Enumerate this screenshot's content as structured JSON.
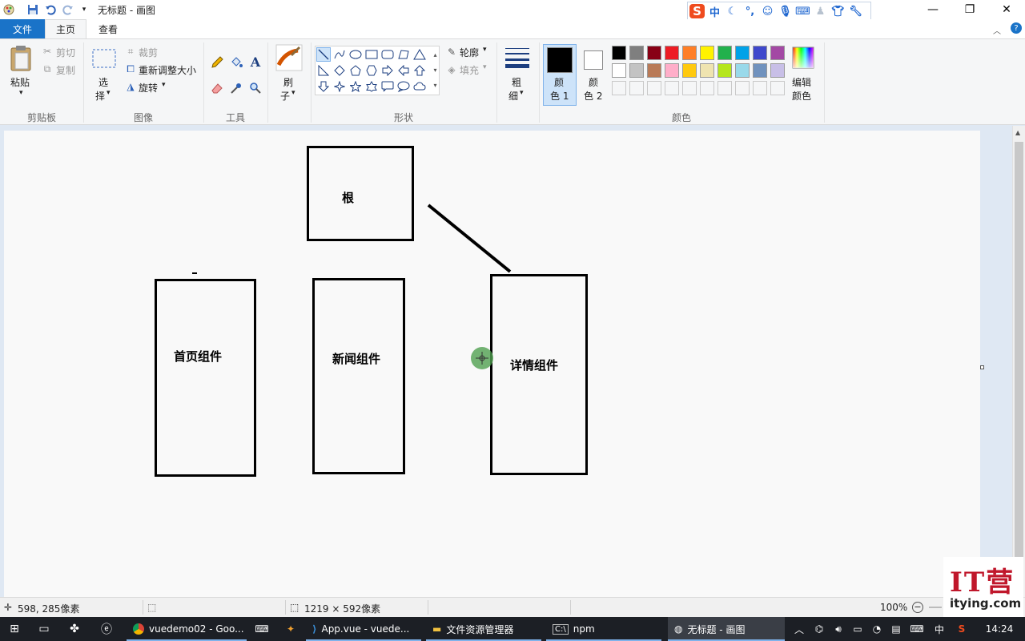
{
  "window": {
    "title": "无标题 - 画图"
  },
  "ime": {
    "logo": "S",
    "lang": "中",
    "icons": [
      "moon-icon",
      "punctuation-icon",
      "smiley-icon",
      "microphone-icon",
      "keyboard-icon",
      "user-icon",
      "shirt-icon",
      "wrench-icon"
    ]
  },
  "tabs": {
    "file": "文件",
    "home": "主页",
    "view": "查看"
  },
  "ribbon": {
    "clipboard": {
      "paste": "粘贴",
      "cut": "剪切",
      "copy": "复制",
      "group": "剪贴板"
    },
    "image": {
      "select_line1": "选",
      "select_line2": "择",
      "crop": "裁剪",
      "resize": "重新调整大小",
      "rotate": "旋转",
      "group": "图像"
    },
    "tools": {
      "group": "工具"
    },
    "brushes": {
      "line1": "刷",
      "line2": "子"
    },
    "shapes": {
      "outline": "轮廓",
      "fill": "填充",
      "group": "形状"
    },
    "size": {
      "line1": "粗",
      "line2": "细"
    },
    "colors": {
      "color1_line1": "颜",
      "color1_line2": "色 1",
      "color2_line1": "颜",
      "color2_line2": "色 2",
      "edit_line1": "编辑",
      "edit_line2": "颜色",
      "group": "颜色",
      "color1_value": "#000000",
      "color2_value": "#ffffff",
      "palette_row1": [
        "#000000",
        "#7f7f7f",
        "#880015",
        "#ed1c24",
        "#ff7f27",
        "#fff200",
        "#22b14c",
        "#00a2e8",
        "#3f48cc",
        "#a349a4"
      ],
      "palette_row2": [
        "#ffffff",
        "#c3c3c3",
        "#b97a57",
        "#ffaec9",
        "#ffc90e",
        "#efe4b0",
        "#b5e61d",
        "#99d9ea",
        "#7092be",
        "#c8bfe7"
      ]
    }
  },
  "canvas": {
    "nodes": {
      "root": "根",
      "home": "首页组件",
      "news": "新闻组件",
      "detail": "详情组件"
    }
  },
  "status": {
    "cursor_pos": "598, 285像素",
    "canvas_size": "1219 × 592像素",
    "zoom": "100%"
  },
  "taskbar": {
    "items": [
      "vuedemo02 - Goo...",
      "App.vue - vuede...",
      "文件资源管理器",
      "npm",
      "无标题 - 画图"
    ],
    "ime": "中",
    "time": "14:24"
  },
  "watermark": {
    "big": "IT营",
    "site": "itying.com"
  }
}
